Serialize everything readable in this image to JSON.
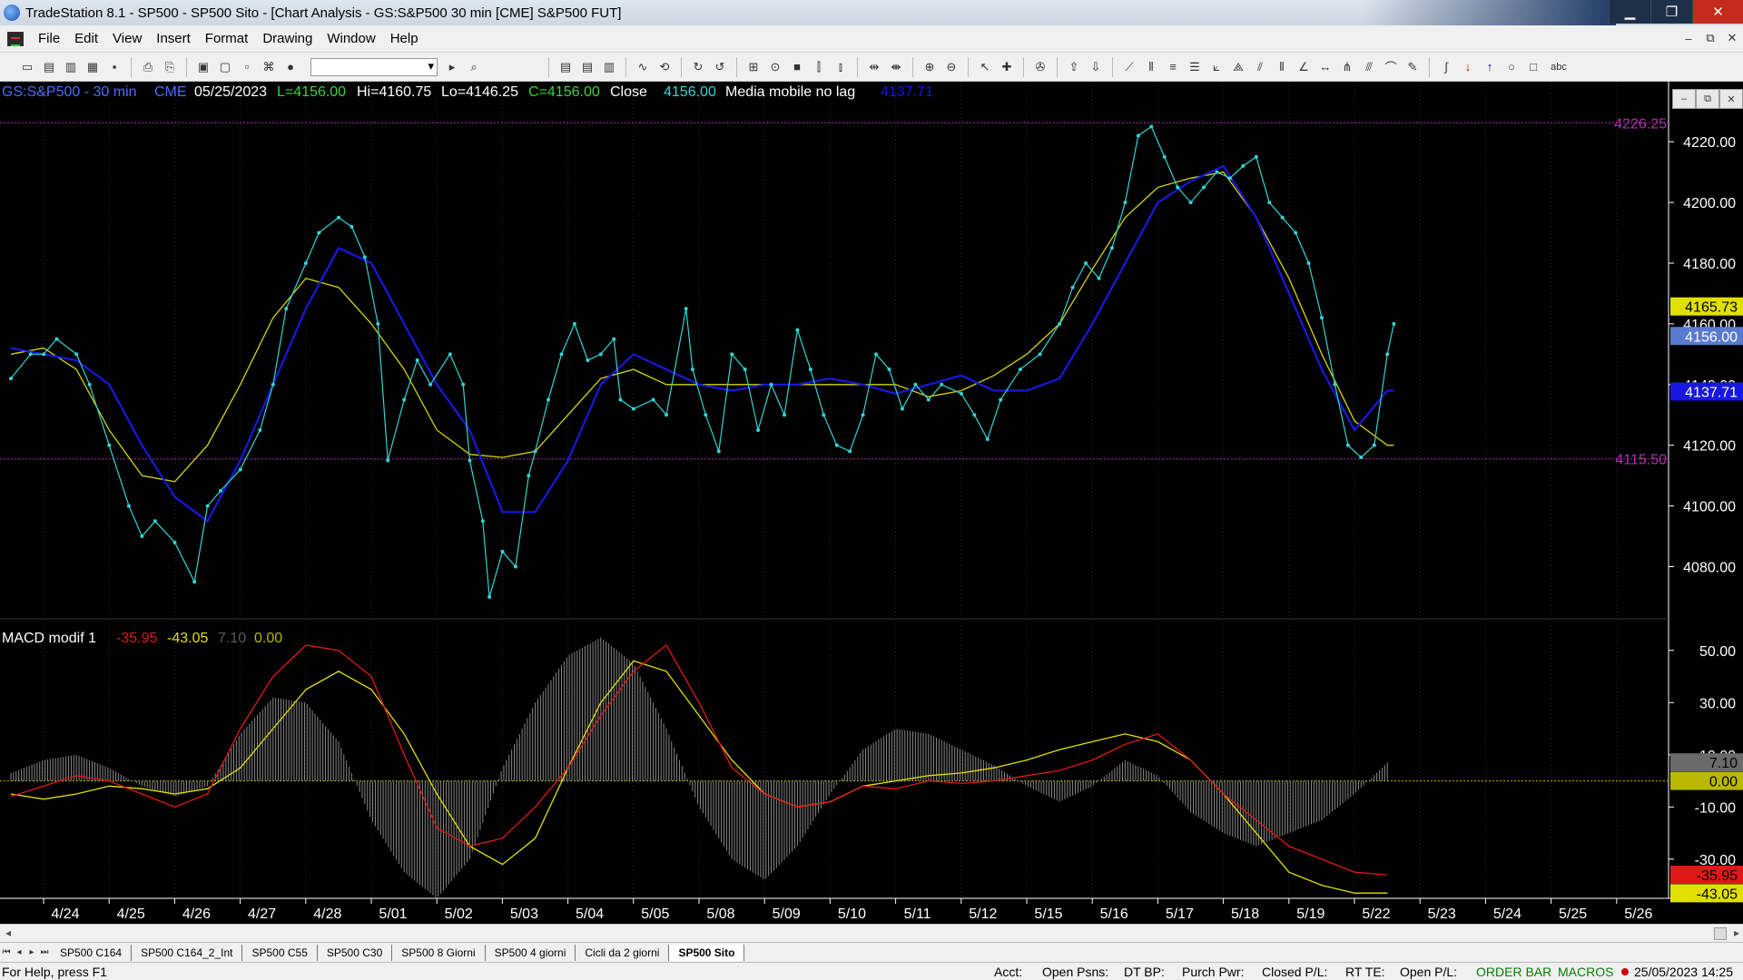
{
  "window": {
    "title": "TradeStation 8.1 - SP500 - SP500 Sito - [Chart Analysis - GS:S&P500  30 min  [CME] S&P500 FUT]",
    "buttons": {
      "minimize": "▁",
      "restore": "❐",
      "close": "✕"
    }
  },
  "menu": [
    "File",
    "Edit",
    "View",
    "Insert",
    "Format",
    "Drawing",
    "Window",
    "Help"
  ],
  "mdi_buttons": {
    "minimize": "–",
    "restore": "⧉",
    "close": "✕"
  },
  "chart_mini_buttons": [
    "–",
    "⧉",
    "✕"
  ],
  "chart_header": {
    "symbol": "GS:S&P500 - 30 min",
    "exchange": "CME",
    "date": "05/25/2023",
    "last": "L=4156.00",
    "high": "Hi=4160.75",
    "low": "Lo=4146.25",
    "close": "C=4156.00",
    "close_label": "Close",
    "close_value": "4156.00",
    "ma_label": "Media mobile no lag",
    "ma_value": "4137.71"
  },
  "macd_header": {
    "label": "MACD modif 1",
    "v1": "-35.95",
    "v2": "-43.05",
    "v3": "7.10",
    "v4": "0.00"
  },
  "colors": {
    "price": "#33d4d4",
    "fast_ma": "#d4d400",
    "slow_ma": "#1818e0",
    "macd_red": "#e01818",
    "macd_yellow": "#e0e000",
    "hist": "#8a8a8a",
    "level": "#b030b0"
  },
  "chart_data": {
    "type": "line",
    "price_axis": {
      "ticks": [
        {
          "v": 4220,
          "label": "4220.00"
        },
        {
          "v": 4200,
          "label": "4200.00"
        },
        {
          "v": 4180,
          "label": "4180.00"
        },
        {
          "v": 4160,
          "label": "4160.00"
        },
        {
          "v": 4140,
          "label": "4140.00"
        },
        {
          "v": 4120,
          "label": "4120.00"
        },
        {
          "v": 4100,
          "label": "4100.00"
        },
        {
          "v": 4080,
          "label": "4080.00"
        }
      ],
      "range": [
        4064,
        4235
      ]
    },
    "price_levels": [
      {
        "v": 4226.25,
        "label": "4226.25"
      },
      {
        "v": 4115.5,
        "label": "4115.50"
      }
    ],
    "price_markers": [
      {
        "v": 4165.73,
        "label": "4165.73",
        "bg": "#e0e000",
        "fg": "#000000"
      },
      {
        "v": 4156.0,
        "label": "4156.00",
        "bg": "#5a7ad0",
        "fg": "#ffffff"
      },
      {
        "v": 4137.71,
        "label": "4137.71",
        "bg": "#1818e0",
        "fg": "#ffffff"
      }
    ],
    "x_labels": [
      "4/24",
      "4/25",
      "4/26",
      "4/27",
      "4/28",
      "5/01",
      "5/02",
      "5/03",
      "5/04",
      "5/05",
      "5/08",
      "5/09",
      "5/10",
      "5/11",
      "5/12",
      "5/15",
      "5/16",
      "5/17",
      "5/18",
      "5/19",
      "5/22",
      "5/23",
      "5/24",
      "5/25",
      "5/26"
    ],
    "price": [
      [
        0,
        4142
      ],
      [
        0.3,
        4150
      ],
      [
        0.5,
        4150
      ],
      [
        0.7,
        4155
      ],
      [
        1,
        4150
      ],
      [
        1.2,
        4140
      ],
      [
        1.5,
        4120
      ],
      [
        1.8,
        4100
      ],
      [
        2,
        4090
      ],
      [
        2.2,
        4095
      ],
      [
        2.5,
        4088
      ],
      [
        2.8,
        4075
      ],
      [
        3,
        4100
      ],
      [
        3.2,
        4105
      ],
      [
        3.5,
        4112
      ],
      [
        3.8,
        4125
      ],
      [
        4,
        4140
      ],
      [
        4.2,
        4165
      ],
      [
        4.5,
        4180
      ],
      [
        4.7,
        4190
      ],
      [
        5,
        4195
      ],
      [
        5.2,
        4192
      ],
      [
        5.4,
        4182
      ],
      [
        5.6,
        4160
      ],
      [
        5.75,
        4115
      ],
      [
        6,
        4135
      ],
      [
        6.2,
        4148
      ],
      [
        6.4,
        4140
      ],
      [
        6.7,
        4150
      ],
      [
        6.9,
        4140
      ],
      [
        7,
        4115
      ],
      [
        7.2,
        4095
      ],
      [
        7.3,
        4070
      ],
      [
        7.5,
        4085
      ],
      [
        7.7,
        4080
      ],
      [
        7.9,
        4110
      ],
      [
        8,
        4118
      ],
      [
        8.2,
        4135
      ],
      [
        8.4,
        4150
      ],
      [
        8.6,
        4160
      ],
      [
        8.8,
        4148
      ],
      [
        9,
        4150
      ],
      [
        9.2,
        4155
      ],
      [
        9.3,
        4135
      ],
      [
        9.5,
        4132
      ],
      [
        9.8,
        4135
      ],
      [
        10,
        4130
      ],
      [
        10.3,
        4165
      ],
      [
        10.4,
        4145
      ],
      [
        10.6,
        4130
      ],
      [
        10.8,
        4118
      ],
      [
        11,
        4150
      ],
      [
        11.2,
        4145
      ],
      [
        11.4,
        4125
      ],
      [
        11.6,
        4140
      ],
      [
        11.8,
        4130
      ],
      [
        12,
        4158
      ],
      [
        12.2,
        4145
      ],
      [
        12.4,
        4130
      ],
      [
        12.6,
        4120
      ],
      [
        12.8,
        4118
      ],
      [
        13,
        4130
      ],
      [
        13.2,
        4150
      ],
      [
        13.4,
        4145
      ],
      [
        13.6,
        4132
      ],
      [
        13.8,
        4140
      ],
      [
        14,
        4135
      ],
      [
        14.2,
        4140
      ],
      [
        14.5,
        4137
      ],
      [
        14.7,
        4130
      ],
      [
        14.9,
        4122
      ],
      [
        15.1,
        4135
      ],
      [
        15.4,
        4145
      ],
      [
        15.7,
        4150
      ],
      [
        16,
        4160
      ],
      [
        16.2,
        4172
      ],
      [
        16.4,
        4180
      ],
      [
        16.6,
        4175
      ],
      [
        16.8,
        4185
      ],
      [
        17,
        4200
      ],
      [
        17.2,
        4222
      ],
      [
        17.4,
        4225
      ],
      [
        17.6,
        4215
      ],
      [
        17.8,
        4205
      ],
      [
        18,
        4200
      ],
      [
        18.2,
        4205
      ],
      [
        18.4,
        4210
      ],
      [
        18.6,
        4208
      ],
      [
        18.8,
        4212
      ],
      [
        19,
        4215
      ],
      [
        19.2,
        4200
      ],
      [
        19.4,
        4195
      ],
      [
        19.6,
        4190
      ],
      [
        19.8,
        4180
      ],
      [
        20,
        4162
      ],
      [
        20.2,
        4140
      ],
      [
        20.4,
        4120
      ],
      [
        20.6,
        4116
      ],
      [
        20.8,
        4120
      ],
      [
        21,
        4150
      ],
      [
        21.1,
        4160
      ]
    ],
    "fast_ma": [
      [
        0,
        4150
      ],
      [
        0.5,
        4152
      ],
      [
        1,
        4145
      ],
      [
        1.5,
        4125
      ],
      [
        2,
        4110
      ],
      [
        2.5,
        4108
      ],
      [
        3,
        4120
      ],
      [
        3.5,
        4140
      ],
      [
        4,
        4162
      ],
      [
        4.5,
        4175
      ],
      [
        5,
        4172
      ],
      [
        5.5,
        4160
      ],
      [
        6,
        4145
      ],
      [
        6.5,
        4125
      ],
      [
        7,
        4117
      ],
      [
        7.5,
        4116
      ],
      [
        8,
        4118
      ],
      [
        8.5,
        4130
      ],
      [
        9,
        4142
      ],
      [
        9.5,
        4145
      ],
      [
        10,
        4140
      ],
      [
        10.5,
        4140
      ],
      [
        11,
        4140
      ],
      [
        11.5,
        4140
      ],
      [
        12,
        4140
      ],
      [
        12.5,
        4140
      ],
      [
        13,
        4140
      ],
      [
        13.5,
        4140
      ],
      [
        14,
        4136
      ],
      [
        14.5,
        4138
      ],
      [
        15,
        4143
      ],
      [
        15.5,
        4150
      ],
      [
        16,
        4160
      ],
      [
        16.5,
        4178
      ],
      [
        17,
        4195
      ],
      [
        17.5,
        4205
      ],
      [
        18,
        4208
      ],
      [
        18.5,
        4210
      ],
      [
        19,
        4195
      ],
      [
        19.5,
        4175
      ],
      [
        20,
        4150
      ],
      [
        20.5,
        4128
      ],
      [
        21,
        4120
      ],
      [
        21.1,
        4120
      ]
    ],
    "slow_ma": [
      [
        0,
        4152
      ],
      [
        0.5,
        4150
      ],
      [
        1,
        4148
      ],
      [
        1.5,
        4140
      ],
      [
        2,
        4120
      ],
      [
        2.5,
        4103
      ],
      [
        3,
        4095
      ],
      [
        3.5,
        4115
      ],
      [
        4,
        4140
      ],
      [
        4.5,
        4165
      ],
      [
        5,
        4185
      ],
      [
        5.5,
        4180
      ],
      [
        6,
        4160
      ],
      [
        6.5,
        4140
      ],
      [
        7,
        4125
      ],
      [
        7.5,
        4098
      ],
      [
        8,
        4098
      ],
      [
        8.5,
        4115
      ],
      [
        9,
        4140
      ],
      [
        9.5,
        4150
      ],
      [
        10,
        4145
      ],
      [
        10.5,
        4140
      ],
      [
        11,
        4138
      ],
      [
        11.5,
        4140
      ],
      [
        12,
        4140
      ],
      [
        12.5,
        4142
      ],
      [
        13,
        4140
      ],
      [
        13.5,
        4137
      ],
      [
        14,
        4140
      ],
      [
        14.5,
        4143
      ],
      [
        15,
        4138
      ],
      [
        15.5,
        4138
      ],
      [
        16,
        4142
      ],
      [
        16.5,
        4160
      ],
      [
        17,
        4180
      ],
      [
        17.5,
        4200
      ],
      [
        18,
        4207
      ],
      [
        18.5,
        4212
      ],
      [
        19,
        4195
      ],
      [
        19.5,
        4170
      ],
      [
        20,
        4145
      ],
      [
        20.5,
        4125
      ],
      [
        21,
        4138
      ],
      [
        21.1,
        4138
      ]
    ],
    "macd_axis": {
      "ticks": [
        {
          "v": 50,
          "label": "50.00"
        },
        {
          "v": 30,
          "label": "30.00"
        },
        {
          "v": 10,
          "label": "10.00"
        },
        {
          "v": -10,
          "label": "-10.00"
        },
        {
          "v": -30,
          "label": "-30.00"
        }
      ],
      "range": [
        -45,
        60
      ]
    },
    "macd_markers": [
      {
        "v": 7.1,
        "label": "7.10",
        "bg": "#6a6a6a",
        "fg": "#000000"
      },
      {
        "v": 0,
        "label": "0.00",
        "bg": "#b8b800",
        "fg": "#000000"
      },
      {
        "v": -35.95,
        "label": "-35.95",
        "bg": "#e01818",
        "fg": "#000000"
      },
      {
        "v": -43.05,
        "label": "-43.05",
        "bg": "#e0e000",
        "fg": "#000000"
      }
    ],
    "macd_red": [
      [
        0,
        -6
      ],
      [
        0.5,
        -2
      ],
      [
        1,
        2
      ],
      [
        1.5,
        0
      ],
      [
        2,
        -5
      ],
      [
        2.5,
        -10
      ],
      [
        3,
        -5
      ],
      [
        3.5,
        20
      ],
      [
        4,
        40
      ],
      [
        4.5,
        52
      ],
      [
        5,
        50
      ],
      [
        5.5,
        40
      ],
      [
        6,
        10
      ],
      [
        6.5,
        -18
      ],
      [
        7,
        -25
      ],
      [
        7.5,
        -22
      ],
      [
        8,
        -10
      ],
      [
        8.5,
        5
      ],
      [
        9,
        25
      ],
      [
        9.5,
        42
      ],
      [
        10,
        52
      ],
      [
        10.5,
        30
      ],
      [
        11,
        5
      ],
      [
        11.5,
        -5
      ],
      [
        12,
        -10
      ],
      [
        12.5,
        -8
      ],
      [
        13,
        -2
      ],
      [
        13.5,
        -3
      ],
      [
        14,
        0
      ],
      [
        14.5,
        -1
      ],
      [
        15,
        0
      ],
      [
        15.5,
        2
      ],
      [
        16,
        4
      ],
      [
        16.5,
        8
      ],
      [
        17,
        14
      ],
      [
        17.5,
        18
      ],
      [
        18,
        8
      ],
      [
        18.5,
        -5
      ],
      [
        19,
        -15
      ],
      [
        19.5,
        -25
      ],
      [
        20,
        -30
      ],
      [
        20.5,
        -35
      ],
      [
        21,
        -36
      ]
    ],
    "macd_yellow": [
      [
        0,
        -5
      ],
      [
        0.5,
        -7
      ],
      [
        1,
        -5
      ],
      [
        1.5,
        -2
      ],
      [
        2,
        -3
      ],
      [
        2.5,
        -5
      ],
      [
        3,
        -3
      ],
      [
        3.5,
        5
      ],
      [
        4,
        20
      ],
      [
        4.5,
        35
      ],
      [
        5,
        42
      ],
      [
        5.5,
        35
      ],
      [
        6,
        18
      ],
      [
        6.5,
        -5
      ],
      [
        7,
        -25
      ],
      [
        7.5,
        -32
      ],
      [
        8,
        -22
      ],
      [
        8.5,
        5
      ],
      [
        9,
        30
      ],
      [
        9.5,
        46
      ],
      [
        10,
        42
      ],
      [
        10.5,
        25
      ],
      [
        11,
        8
      ],
      [
        11.5,
        -5
      ],
      [
        12,
        -10
      ],
      [
        12.5,
        -8
      ],
      [
        13,
        -2
      ],
      [
        13.5,
        0
      ],
      [
        14,
        2
      ],
      [
        14.5,
        3
      ],
      [
        15,
        5
      ],
      [
        15.5,
        8
      ],
      [
        16,
        12
      ],
      [
        16.5,
        15
      ],
      [
        17,
        18
      ],
      [
        17.5,
        15
      ],
      [
        18,
        8
      ],
      [
        18.5,
        -5
      ],
      [
        19,
        -20
      ],
      [
        19.5,
        -35
      ],
      [
        20,
        -40
      ],
      [
        20.5,
        -43
      ],
      [
        21,
        -43
      ]
    ],
    "macd_hist": [
      [
        0,
        3
      ],
      [
        0.5,
        8
      ],
      [
        1,
        10
      ],
      [
        1.5,
        5
      ],
      [
        2,
        -2
      ],
      [
        2.5,
        -6
      ],
      [
        3,
        -2
      ],
      [
        3.5,
        18
      ],
      [
        4,
        32
      ],
      [
        4.5,
        30
      ],
      [
        5,
        15
      ],
      [
        5.5,
        -15
      ],
      [
        6,
        -35
      ],
      [
        6.5,
        -45
      ],
      [
        7,
        -30
      ],
      [
        7.5,
        5
      ],
      [
        8,
        30
      ],
      [
        8.5,
        48
      ],
      [
        9,
        55
      ],
      [
        9.5,
        45
      ],
      [
        10,
        20
      ],
      [
        10.5,
        -10
      ],
      [
        11,
        -30
      ],
      [
        11.5,
        -38
      ],
      [
        12,
        -25
      ],
      [
        12.5,
        -5
      ],
      [
        13,
        12
      ],
      [
        13.5,
        20
      ],
      [
        14,
        18
      ],
      [
        14.5,
        12
      ],
      [
        15,
        6
      ],
      [
        15.5,
        -2
      ],
      [
        16,
        -8
      ],
      [
        16.5,
        -2
      ],
      [
        17,
        8
      ],
      [
        17.5,
        2
      ],
      [
        18,
        -12
      ],
      [
        18.5,
        -20
      ],
      [
        19,
        -25
      ],
      [
        19.5,
        -20
      ],
      [
        20,
        -15
      ],
      [
        20.5,
        -5
      ],
      [
        21,
        7
      ]
    ]
  },
  "tabs": {
    "items": [
      "SP500 C164",
      "SP500 C164_2_Int",
      "SP500 C55",
      "SP500 C30",
      "SP500 8 Giorni",
      "SP500 4 giorni",
      "Cicli da 2 giorni",
      "SP500 Sito"
    ],
    "active": 7
  },
  "status": {
    "help": "For Help, press F1",
    "acct": "Acct:",
    "open_psns": "Open Psns:",
    "dt_bp": "DT BP:",
    "purch_pwr": "Purch Pwr:",
    "closed_pl": "Closed P/L:",
    "rt_te": "RT TE:",
    "open_pl": "Open P/L:",
    "order_bar": "ORDER BAR",
    "macros": "MACROS",
    "datetime": "25/05/2023 14:25"
  }
}
